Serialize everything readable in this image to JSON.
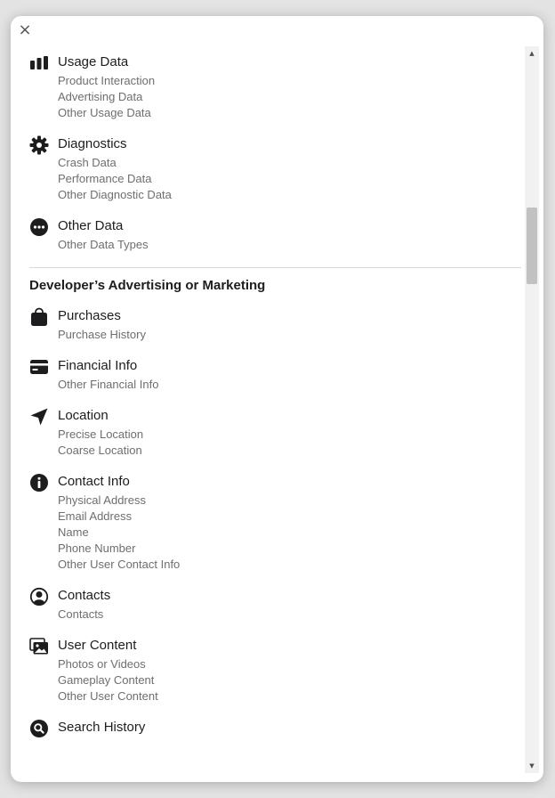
{
  "modal": {
    "close_label": "×",
    "groups_top": [
      {
        "icon": "bar-chart-icon",
        "label": "Usage Data",
        "items": [
          "Product Interaction",
          "Advertising Data",
          "Other Usage Data"
        ]
      },
      {
        "icon": "gear-icon",
        "label": "Diagnostics",
        "items": [
          "Crash Data",
          "Performance Data",
          "Other Diagnostic Data"
        ]
      },
      {
        "icon": "more-circle-icon",
        "label": "Other Data",
        "items": [
          "Other Data Types"
        ]
      }
    ],
    "section_title": "Developer’s Advertising or Marketing",
    "groups_bottom": [
      {
        "icon": "shopping-bag-icon",
        "label": "Purchases",
        "items": [
          "Purchase History"
        ]
      },
      {
        "icon": "credit-card-icon",
        "label": "Financial Info",
        "items": [
          "Other Financial Info"
        ]
      },
      {
        "icon": "location-arrow-icon",
        "label": "Location",
        "items": [
          "Precise Location",
          "Coarse Location"
        ]
      },
      {
        "icon": "info-circle-icon",
        "label": "Contact Info",
        "items": [
          "Physical Address",
          "Email Address",
          "Name",
          "Phone Number",
          "Other User Contact Info"
        ]
      },
      {
        "icon": "person-circle-icon",
        "label": "Contacts",
        "items": [
          "Contacts"
        ]
      },
      {
        "icon": "photos-icon",
        "label": "User Content",
        "items": [
          "Photos or Videos",
          "Gameplay Content",
          "Other User Content"
        ]
      },
      {
        "icon": "search-circle-icon",
        "label": "Search History",
        "items": []
      }
    ]
  },
  "scrollbar": {
    "up_glyph": "▲",
    "down_glyph": "▼",
    "position_fraction": 0.22
  }
}
